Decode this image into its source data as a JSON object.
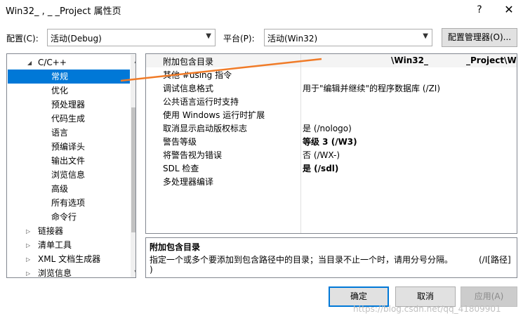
{
  "window": {
    "title": "Win32_  ,  _    _Project 属性页",
    "help_glyph": "?",
    "close_glyph": "✕"
  },
  "toolbar": {
    "config_label": "配置(C):",
    "config_value": "活动(Debug)",
    "platform_label": "平台(P):",
    "platform_value": "活动(Win32)",
    "config_manager_label": "配置管理器(O)..."
  },
  "tree": {
    "items": [
      {
        "label": "C/C++",
        "expander": "expanded"
      },
      {
        "label": "常规",
        "selected": true
      },
      {
        "label": "优化"
      },
      {
        "label": "预处理器"
      },
      {
        "label": "代码生成"
      },
      {
        "label": "语言"
      },
      {
        "label": "预编译头"
      },
      {
        "label": "输出文件"
      },
      {
        "label": "浏览信息"
      },
      {
        "label": "高级"
      },
      {
        "label": "所有选项"
      },
      {
        "label": "命令行"
      },
      {
        "label": "链接器",
        "expander": "collapsed"
      },
      {
        "label": "清单工具",
        "expander": "collapsed"
      },
      {
        "label": "XML 文档生成器",
        "expander": "collapsed"
      },
      {
        "label": "浏览信息",
        "expander": "collapsed"
      }
    ]
  },
  "grid": {
    "rows": [
      {
        "name": "附加包含目录",
        "value": ""
      },
      {
        "name": "其他 #using 指令",
        "value": ""
      },
      {
        "name": "调试信息格式",
        "value": "用于\"编辑并继续\"的程序数据库 (/ZI)"
      },
      {
        "name": "公共语言运行时支持",
        "value": ""
      },
      {
        "name": "使用 Windows 运行时扩展",
        "value": ""
      },
      {
        "name": "取消显示启动版权标志",
        "value": "是 (/nologo)"
      },
      {
        "name": "警告等级",
        "value": "等级 3 (/W3)",
        "bold": true
      },
      {
        "name": "将警告视为错误",
        "value": "否 (/WX-)"
      },
      {
        "name": "SDL 检查",
        "value": "是 (/sdl)",
        "bold": true
      },
      {
        "name": "多处理器编译",
        "value": ""
      }
    ],
    "path_seg1": "\\Win32_",
    "path_seg2": "_Project\\Wi"
  },
  "description": {
    "title": "附加包含目录",
    "text": "指定一个或多个要添加到包含路径中的目录；当目录不止一个时，请用分号分隔。",
    "flag": "(/I[路径]",
    "text_end": ")"
  },
  "buttons": {
    "ok": "确定",
    "cancel": "取消",
    "apply": "应用(A)"
  },
  "watermark": "https://blog.csdn.net/qq_41809901",
  "colors": {
    "selection": "#0078d7",
    "annotation_line": "#f07b28"
  }
}
